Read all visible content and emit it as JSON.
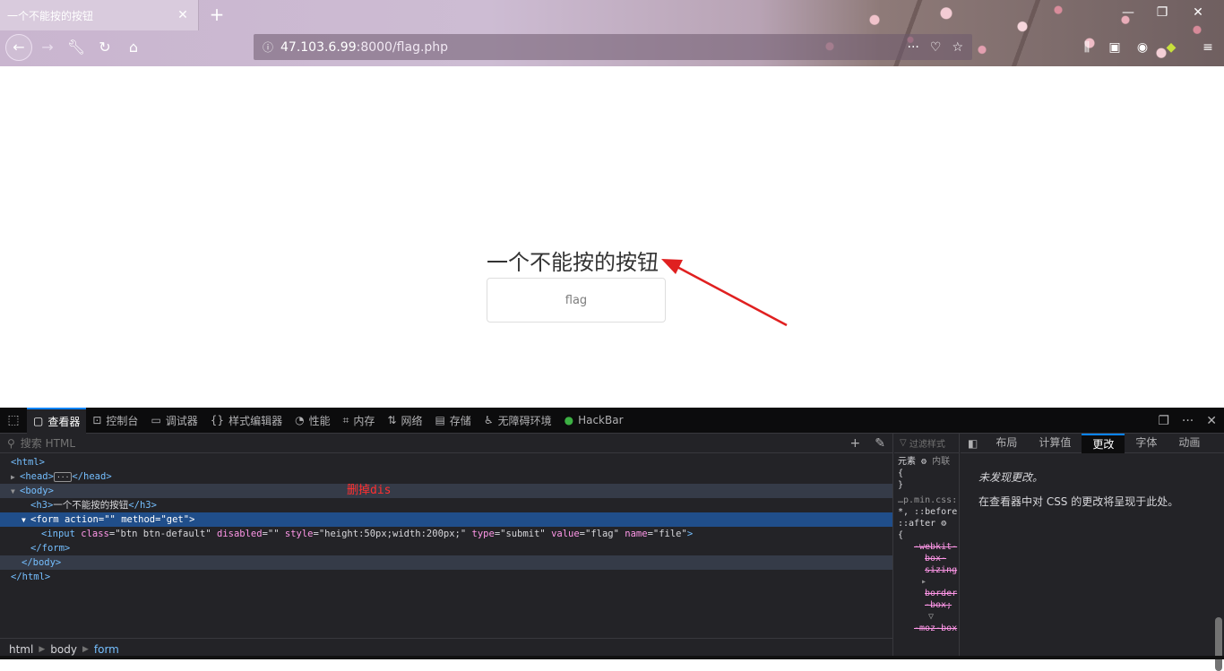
{
  "browser": {
    "tab_title": "一个不能按的按钮",
    "tab_close": "✕",
    "new_tab": "+",
    "url_host": "47.103.6.99",
    "url_rest": ":8000/flag.php",
    "url_info_icon": "ⓘ",
    "url_more": "···"
  },
  "page": {
    "heading": "一个不能按的按钮",
    "button_value": "flag"
  },
  "devtools": {
    "tabs": [
      {
        "label": "查看器",
        "icon": "inspector-icon"
      },
      {
        "label": "控制台",
        "icon": "console-icon"
      },
      {
        "label": "调试器",
        "icon": "debugger-icon"
      },
      {
        "label": "样式编辑器",
        "icon": "style-editor-icon"
      },
      {
        "label": "性能",
        "icon": "performance-icon"
      },
      {
        "label": "内存",
        "icon": "memory-icon"
      },
      {
        "label": "网络",
        "icon": "network-icon"
      },
      {
        "label": "存储",
        "icon": "storage-icon"
      },
      {
        "label": "无障碍环境",
        "icon": "accessibility-icon"
      },
      {
        "label": "HackBar",
        "icon": "hackbar-icon"
      }
    ],
    "search_placeholder": "搜索 HTML",
    "tree": {
      "html_open": "<html>",
      "head_open": "<head>",
      "head_close": "</head>",
      "body_open": "<body>",
      "h3_open": "<h3>",
      "h3_text": "一个不能按的按钮",
      "h3_close": "</h3>",
      "form_tag": "<form",
      "form_attr1": "action",
      "form_val1": "\"\"",
      "form_attr2": "method",
      "form_val2": "\"get\"",
      "form_end": ">",
      "input_tag": "<input",
      "input_attrs": [
        {
          "name": "class",
          "value": "\"btn btn-default\""
        },
        {
          "name": "disabled",
          "value": "\"\""
        },
        {
          "name": "style",
          "value": "\"height:50px;width:200px;\""
        },
        {
          "name": "type",
          "value": "\"submit\""
        },
        {
          "name": "value",
          "value": "\"flag\""
        },
        {
          "name": "name",
          "value": "\"file\""
        }
      ],
      "input_end": ">",
      "form_close": "</form>",
      "body_close": "</body>",
      "html_close": "</html>"
    },
    "annotation": "删掉dis",
    "breadcrumbs": [
      "html",
      "body",
      "form"
    ],
    "rules": {
      "filter": "过滤样式",
      "element": "元素",
      "inner": "内联",
      "brace_open": "{",
      "brace_close": "}",
      "source": "…p.min.css:",
      "selector": "*, ::before,",
      "selector2": "::after",
      "prop1": "-webkit-",
      "prop1b": "box-",
      "prop1c": "sizing",
      "prop2": "border",
      "prop2b": "-box;",
      "prop3": "-moz-box"
    },
    "side_tabs": [
      "布局",
      "计算值",
      "更改",
      "字体",
      "动画"
    ],
    "side_active": "更改",
    "side_msg1": "未发现更改。",
    "side_msg2": "在查看器中对 CSS 的更改将呈现于此处。"
  }
}
